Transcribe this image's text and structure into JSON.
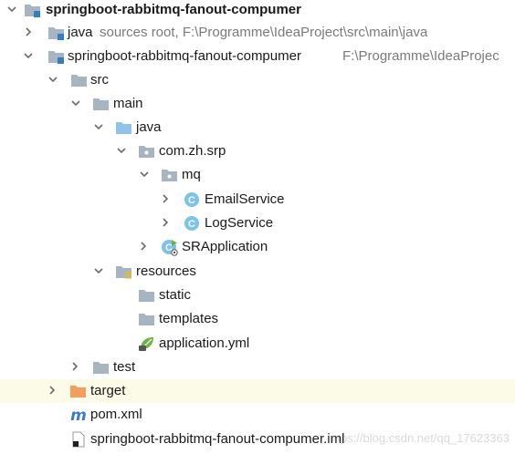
{
  "colors": {
    "folder": "#a7b5c2",
    "source_folder": "#8ec4ec",
    "excluded_folder": "#f49d5c",
    "selected_row": "#fbfbe7",
    "class_circle": "#7bc3ee",
    "spring_leaf": "#6db33f",
    "arrow": "#6b6b6b",
    "hint_text": "#7a7a7a"
  },
  "tree": {
    "root": {
      "label": "springboot-rabbitmq-fanout-compumer",
      "icon": "module-folder-icon",
      "expanded": true
    },
    "java_root": {
      "label": "java",
      "hint": "sources root,  F:\\Programme\\IdeaProject\\src\\main\\java",
      "icon": "source-folder-icon",
      "expanded": false
    },
    "module": {
      "label": "springboot-rabbitmq-fanout-compumer",
      "hint": "F:\\Programme\\IdeaProjec",
      "icon": "module-folder-icon",
      "expanded": true
    },
    "src": {
      "label": "src",
      "icon": "folder-icon",
      "expanded": true
    },
    "main": {
      "label": "main",
      "icon": "folder-icon",
      "expanded": true
    },
    "java": {
      "label": "java",
      "icon": "source-folder-icon",
      "expanded": true
    },
    "package": {
      "label": "com.zh.srp",
      "icon": "package-icon",
      "expanded": true
    },
    "mq": {
      "label": "mq",
      "icon": "package-icon",
      "expanded": true
    },
    "email_service": {
      "label": "EmailService",
      "icon": "class-icon",
      "expanded": false
    },
    "log_service": {
      "label": "LogService",
      "icon": "class-icon",
      "expanded": false
    },
    "sr_application": {
      "label": "SRApplication",
      "icon": "spring-boot-class-icon",
      "expanded": false
    },
    "resources": {
      "label": "resources",
      "icon": "resources-folder-icon",
      "expanded": true
    },
    "static": {
      "label": "static",
      "icon": "folder-icon"
    },
    "templates": {
      "label": "templates",
      "icon": "folder-icon"
    },
    "application_yml": {
      "label": "application.yml",
      "icon": "spring-yml-icon"
    },
    "test": {
      "label": "test",
      "icon": "folder-icon",
      "expanded": false
    },
    "target": {
      "label": "target",
      "icon": "excluded-folder-icon",
      "expanded": false,
      "selected": true
    },
    "pom": {
      "label": "pom.xml",
      "icon": "maven-icon"
    },
    "iml": {
      "label": "springboot-rabbitmq-fanout-compumer.iml",
      "icon": "iml-file-icon"
    }
  },
  "watermark": "https://blog.csdn.net/qq_17623363"
}
